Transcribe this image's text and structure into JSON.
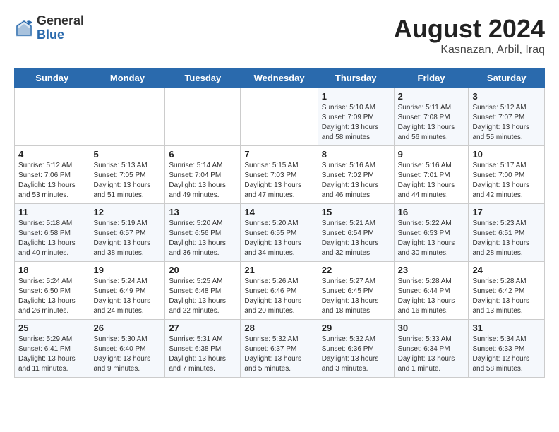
{
  "logo": {
    "general": "General",
    "blue": "Blue"
  },
  "title": {
    "month_year": "August 2024",
    "location": "Kasnazan, Arbil, Iraq"
  },
  "weekdays": [
    "Sunday",
    "Monday",
    "Tuesday",
    "Wednesday",
    "Thursday",
    "Friday",
    "Saturday"
  ],
  "weeks": [
    [
      {
        "day": "",
        "info": ""
      },
      {
        "day": "",
        "info": ""
      },
      {
        "day": "",
        "info": ""
      },
      {
        "day": "",
        "info": ""
      },
      {
        "day": "1",
        "info": "Sunrise: 5:10 AM\nSunset: 7:09 PM\nDaylight: 13 hours\nand 58 minutes."
      },
      {
        "day": "2",
        "info": "Sunrise: 5:11 AM\nSunset: 7:08 PM\nDaylight: 13 hours\nand 56 minutes."
      },
      {
        "day": "3",
        "info": "Sunrise: 5:12 AM\nSunset: 7:07 PM\nDaylight: 13 hours\nand 55 minutes."
      }
    ],
    [
      {
        "day": "4",
        "info": "Sunrise: 5:12 AM\nSunset: 7:06 PM\nDaylight: 13 hours\nand 53 minutes."
      },
      {
        "day": "5",
        "info": "Sunrise: 5:13 AM\nSunset: 7:05 PM\nDaylight: 13 hours\nand 51 minutes."
      },
      {
        "day": "6",
        "info": "Sunrise: 5:14 AM\nSunset: 7:04 PM\nDaylight: 13 hours\nand 49 minutes."
      },
      {
        "day": "7",
        "info": "Sunrise: 5:15 AM\nSunset: 7:03 PM\nDaylight: 13 hours\nand 47 minutes."
      },
      {
        "day": "8",
        "info": "Sunrise: 5:16 AM\nSunset: 7:02 PM\nDaylight: 13 hours\nand 46 minutes."
      },
      {
        "day": "9",
        "info": "Sunrise: 5:16 AM\nSunset: 7:01 PM\nDaylight: 13 hours\nand 44 minutes."
      },
      {
        "day": "10",
        "info": "Sunrise: 5:17 AM\nSunset: 7:00 PM\nDaylight: 13 hours\nand 42 minutes."
      }
    ],
    [
      {
        "day": "11",
        "info": "Sunrise: 5:18 AM\nSunset: 6:58 PM\nDaylight: 13 hours\nand 40 minutes."
      },
      {
        "day": "12",
        "info": "Sunrise: 5:19 AM\nSunset: 6:57 PM\nDaylight: 13 hours\nand 38 minutes."
      },
      {
        "day": "13",
        "info": "Sunrise: 5:20 AM\nSunset: 6:56 PM\nDaylight: 13 hours\nand 36 minutes."
      },
      {
        "day": "14",
        "info": "Sunrise: 5:20 AM\nSunset: 6:55 PM\nDaylight: 13 hours\nand 34 minutes."
      },
      {
        "day": "15",
        "info": "Sunrise: 5:21 AM\nSunset: 6:54 PM\nDaylight: 13 hours\nand 32 minutes."
      },
      {
        "day": "16",
        "info": "Sunrise: 5:22 AM\nSunset: 6:53 PM\nDaylight: 13 hours\nand 30 minutes."
      },
      {
        "day": "17",
        "info": "Sunrise: 5:23 AM\nSunset: 6:51 PM\nDaylight: 13 hours\nand 28 minutes."
      }
    ],
    [
      {
        "day": "18",
        "info": "Sunrise: 5:24 AM\nSunset: 6:50 PM\nDaylight: 13 hours\nand 26 minutes."
      },
      {
        "day": "19",
        "info": "Sunrise: 5:24 AM\nSunset: 6:49 PM\nDaylight: 13 hours\nand 24 minutes."
      },
      {
        "day": "20",
        "info": "Sunrise: 5:25 AM\nSunset: 6:48 PM\nDaylight: 13 hours\nand 22 minutes."
      },
      {
        "day": "21",
        "info": "Sunrise: 5:26 AM\nSunset: 6:46 PM\nDaylight: 13 hours\nand 20 minutes."
      },
      {
        "day": "22",
        "info": "Sunrise: 5:27 AM\nSunset: 6:45 PM\nDaylight: 13 hours\nand 18 minutes."
      },
      {
        "day": "23",
        "info": "Sunrise: 5:28 AM\nSunset: 6:44 PM\nDaylight: 13 hours\nand 16 minutes."
      },
      {
        "day": "24",
        "info": "Sunrise: 5:28 AM\nSunset: 6:42 PM\nDaylight: 13 hours\nand 13 minutes."
      }
    ],
    [
      {
        "day": "25",
        "info": "Sunrise: 5:29 AM\nSunset: 6:41 PM\nDaylight: 13 hours\nand 11 minutes."
      },
      {
        "day": "26",
        "info": "Sunrise: 5:30 AM\nSunset: 6:40 PM\nDaylight: 13 hours\nand 9 minutes."
      },
      {
        "day": "27",
        "info": "Sunrise: 5:31 AM\nSunset: 6:38 PM\nDaylight: 13 hours\nand 7 minutes."
      },
      {
        "day": "28",
        "info": "Sunrise: 5:32 AM\nSunset: 6:37 PM\nDaylight: 13 hours\nand 5 minutes."
      },
      {
        "day": "29",
        "info": "Sunrise: 5:32 AM\nSunset: 6:36 PM\nDaylight: 13 hours\nand 3 minutes."
      },
      {
        "day": "30",
        "info": "Sunrise: 5:33 AM\nSunset: 6:34 PM\nDaylight: 13 hours\nand 1 minute."
      },
      {
        "day": "31",
        "info": "Sunrise: 5:34 AM\nSunset: 6:33 PM\nDaylight: 12 hours\nand 58 minutes."
      }
    ]
  ]
}
